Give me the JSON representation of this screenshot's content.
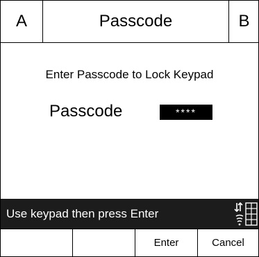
{
  "titlebar": {
    "left_label": "A",
    "title": "Passcode",
    "right_label": "B"
  },
  "main": {
    "prompt": "Enter Passcode to Lock Keypad",
    "passcode_label": "Passcode",
    "passcode_value": "****"
  },
  "statusbar": {
    "message": "Use keypad then press Enter",
    "icon": "keypad-status-icon"
  },
  "softkeys": [
    {
      "label": ""
    },
    {
      "label": ""
    },
    {
      "label": "Enter"
    },
    {
      "label": "Cancel"
    }
  ],
  "colors": {
    "status_bg": "#1c1c1c",
    "field_bg": "#000000",
    "field_text": "#ffffff"
  }
}
